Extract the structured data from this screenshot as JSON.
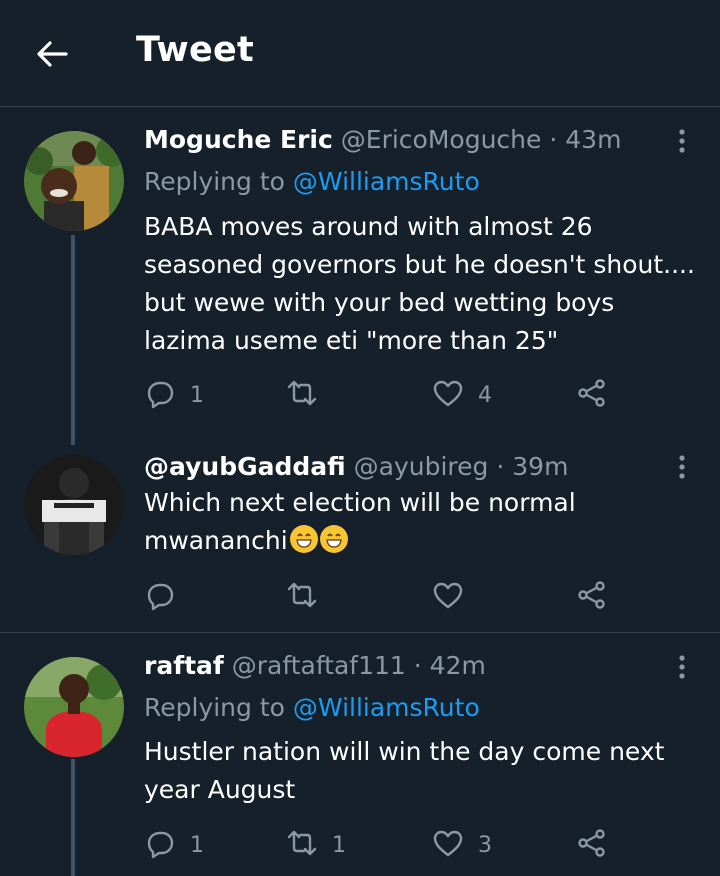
{
  "header": {
    "title": "Tweet"
  },
  "tweets": [
    {
      "name": "Moguche Eric",
      "handle": "@EricoMoguche",
      "time": "· 43m",
      "replying_prefix": "Replying to",
      "replying_to": "@WilliamsRuto",
      "text": "BABA moves around with almost 26 seasoned governors but he doesn't shout.... but wewe with your bed wetting boys lazima useme eti \"more than 25\"",
      "replies": "1",
      "retweets": "",
      "likes": "4"
    },
    {
      "name": "@ayubGaddafi",
      "handle": "@ayubireg",
      "time": "· 39m",
      "text": "Which next election will be normal mwananchi",
      "replies": "",
      "retweets": "",
      "likes": ""
    },
    {
      "name": "raftaf",
      "handle": "@raftaftaf111",
      "time": "· 42m",
      "replying_prefix": "Replying to",
      "replying_to": "@WilliamsRuto",
      "text": "Hustler nation will win the day come next year August",
      "replies": "1",
      "retweets": "1",
      "likes": "3"
    }
  ],
  "icons": {
    "back": "arrow-left-icon",
    "more": "more-vertical-icon",
    "reply": "reply-icon",
    "retweet": "retweet-icon",
    "like": "heart-icon",
    "share": "share-icon"
  },
  "colors": {
    "background": "#15202b",
    "accent": "#1d9bf0",
    "muted": "#8b98a5",
    "divider": "#38444d"
  }
}
